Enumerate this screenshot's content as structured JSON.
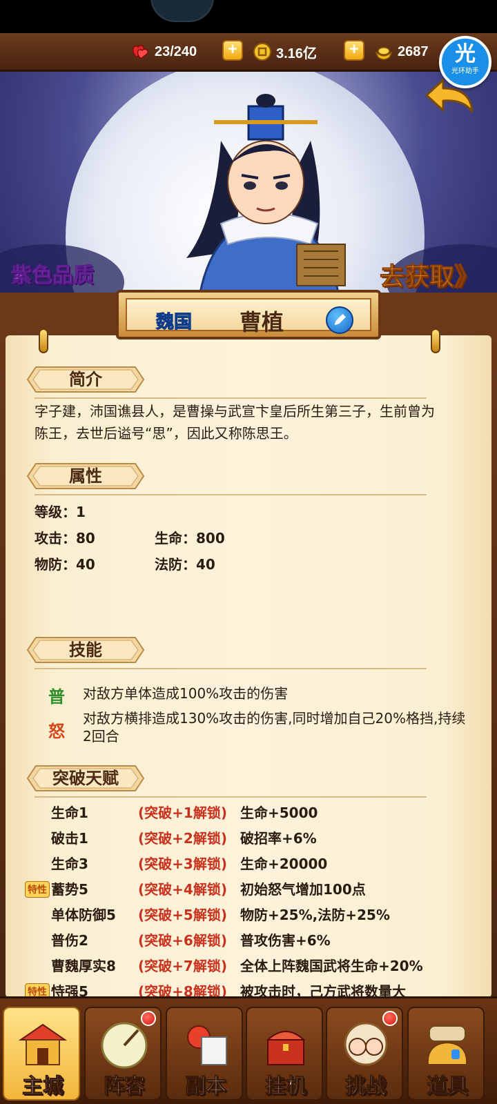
{
  "resources": {
    "stamina": "23/240",
    "coins": "3.16亿",
    "gold": "2687"
  },
  "helper": {
    "title": "光",
    "subtitle": "光环助手"
  },
  "banner": {
    "quality_label": "紫色品质",
    "obtain_label": "去获取》"
  },
  "hero": {
    "kingdom": "魏国",
    "name": "曹植"
  },
  "sections": {
    "intro_title": "简介",
    "intro_text": "字子建，沛国谯县人，是曹操与武宣卞皇后所生第三子，生前曾为陈王，去世后谥号“思”，因此又称陈思王。",
    "attr_title": "属性",
    "skills_title": "技能",
    "talents_title": "突破天赋"
  },
  "attributes": {
    "level": "等级：1",
    "attack": "攻击：80",
    "hp": "生命：800",
    "pdef": "物防：40",
    "mdef": "法防：40"
  },
  "skills": [
    {
      "icon": "普",
      "icon_color": "#2f8f2a",
      "text": "对敌方单体造成100%攻击的伤害"
    },
    {
      "icon": "怒",
      "icon_color": "#d8461c",
      "text": "对敌方横排造成130%攻击的伤害,同时增加自己20%格挡,持续2回合"
    }
  ],
  "talents": [
    {
      "trait": "",
      "name": "生命1",
      "unlock": "(突破+1解锁)",
      "effect": "生命+5000"
    },
    {
      "trait": "",
      "name": "破击1",
      "unlock": "(突破+2解锁)",
      "effect": "破招率+6%"
    },
    {
      "trait": "",
      "name": "生命3",
      "unlock": "(突破+3解锁)",
      "effect": "生命+20000"
    },
    {
      "trait": "特性",
      "name": "蓄势5",
      "unlock": "(突破+4解锁)",
      "effect": "初始怒气增加100点"
    },
    {
      "trait": "",
      "name": "单体防御5",
      "unlock": "(突破+5解锁)",
      "effect": "物防+25%,法防+25%"
    },
    {
      "trait": "",
      "name": "普伤2",
      "unlock": "(突破+6解锁)",
      "effect": "普攻伤害+6%"
    },
    {
      "trait": "",
      "name": "曹魏厚实8",
      "unlock": "(突破+7解锁)",
      "effect": "全体上阵魏国武将生命+20%"
    },
    {
      "trait": "特性",
      "name": "恃强5",
      "unlock": "(突破+8解锁)",
      "effect": "被攻击时，己方武将数量大"
    }
  ],
  "nav": [
    {
      "label": "主城",
      "icon": "palace-icon",
      "active": true,
      "dot": false
    },
    {
      "label": "阵容",
      "icon": "lineup-fan-icon",
      "active": false,
      "dot": true
    },
    {
      "label": "副本",
      "icon": "dungeon-icon",
      "active": false,
      "dot": false
    },
    {
      "label": "挂机",
      "icon": "idle-chest-icon",
      "active": false,
      "dot": false
    },
    {
      "label": "挑战",
      "icon": "challenge-icon",
      "active": false,
      "dot": true
    },
    {
      "label": "道具",
      "icon": "items-bag-icon",
      "active": false,
      "dot": false
    }
  ]
}
